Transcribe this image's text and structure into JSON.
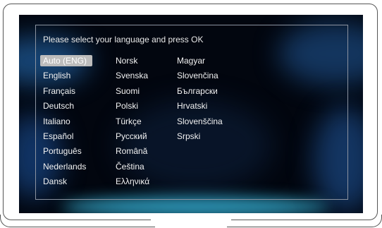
{
  "dialog": {
    "prompt": "Please select your language and press OK",
    "selected": "Auto (ENG)",
    "columns": [
      [
        "Auto (ENG)",
        "English",
        "Français",
        "Deutsch",
        "Italiano",
        "Español",
        "Português",
        "Nederlands",
        "Dansk"
      ],
      [
        "Norsk",
        "Svenska",
        "Suomi",
        "Polski",
        "Türkçe",
        "Русский",
        "Română",
        "Čeština",
        "Ελληνικά"
      ],
      [
        "Magyar",
        "Slovenčina",
        "Български",
        "Hrvatski",
        "Slovenščina",
        "Srpski"
      ]
    ]
  },
  "colors": {
    "highlight": "#bdbdbd",
    "screen_bg": "#02060f",
    "text": "#f2f2f2"
  }
}
